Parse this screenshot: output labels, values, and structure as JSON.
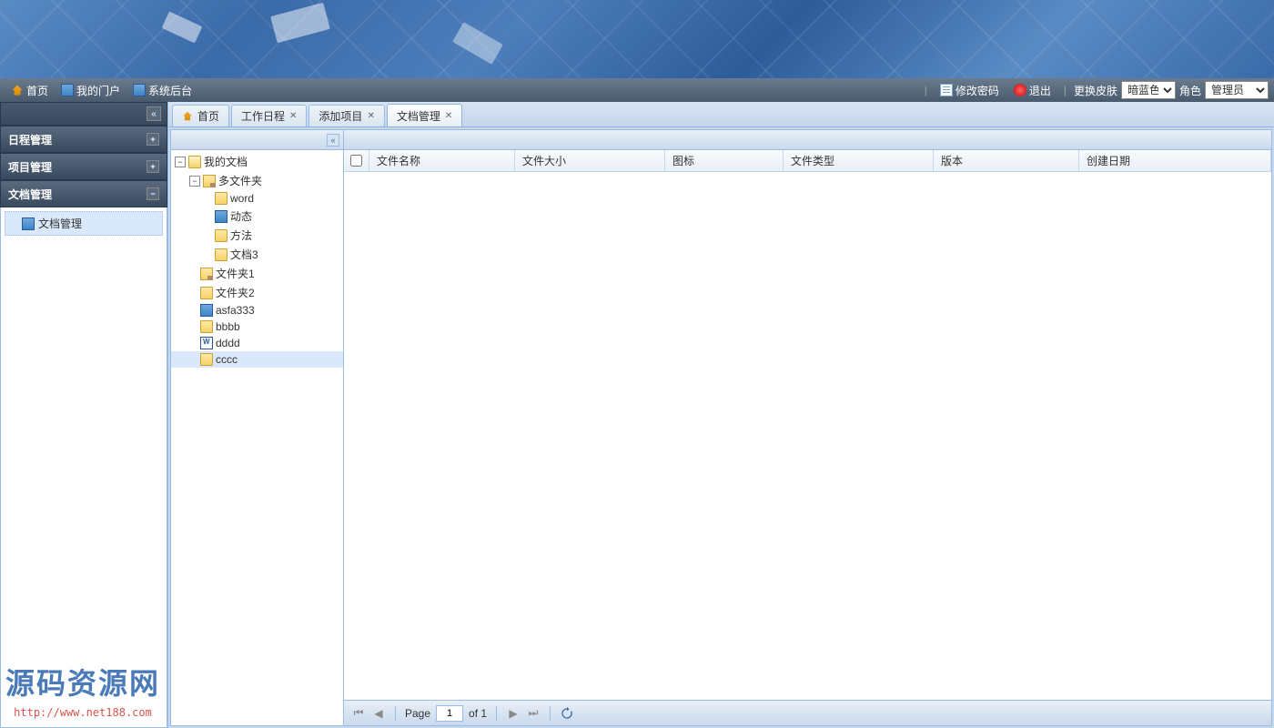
{
  "topbar": {
    "home": "首页",
    "portal": "我的门户",
    "admin": "系统后台",
    "change_pwd": "修改密码",
    "logout": "退出",
    "skin_label": "更换皮肤",
    "skin_value": "暗蓝色",
    "role_label": "角色",
    "role_value": "管理员"
  },
  "sidebar": {
    "schedule": "日程管理",
    "project": "项目管理",
    "document": "文档管理",
    "doc_mgmt_item": "文档管理"
  },
  "tabs": {
    "home": "首页",
    "schedule": "工作日程",
    "add_project": "添加项目",
    "doc_mgmt": "文档管理"
  },
  "tree": {
    "root": "我的文档",
    "multi_folder": "多文件夹",
    "word": "word",
    "dynamic": "动态",
    "method": "方法",
    "doc3": "文档3",
    "folder1": "文件夹1",
    "folder2": "文件夹2",
    "asfa": "asfa333",
    "bbbb": "bbbb",
    "dddd": "dddd",
    "cccc": "cccc"
  },
  "grid": {
    "col_name": "文件名称",
    "col_size": "文件大小",
    "col_icon": "图标",
    "col_type": "文件类型",
    "col_version": "版本",
    "col_date": "创建日期"
  },
  "paging": {
    "page_label": "Page",
    "page_value": "1",
    "of_label": "of 1"
  },
  "watermark": {
    "title": "源码资源网",
    "url": "http://www.net188.com"
  }
}
